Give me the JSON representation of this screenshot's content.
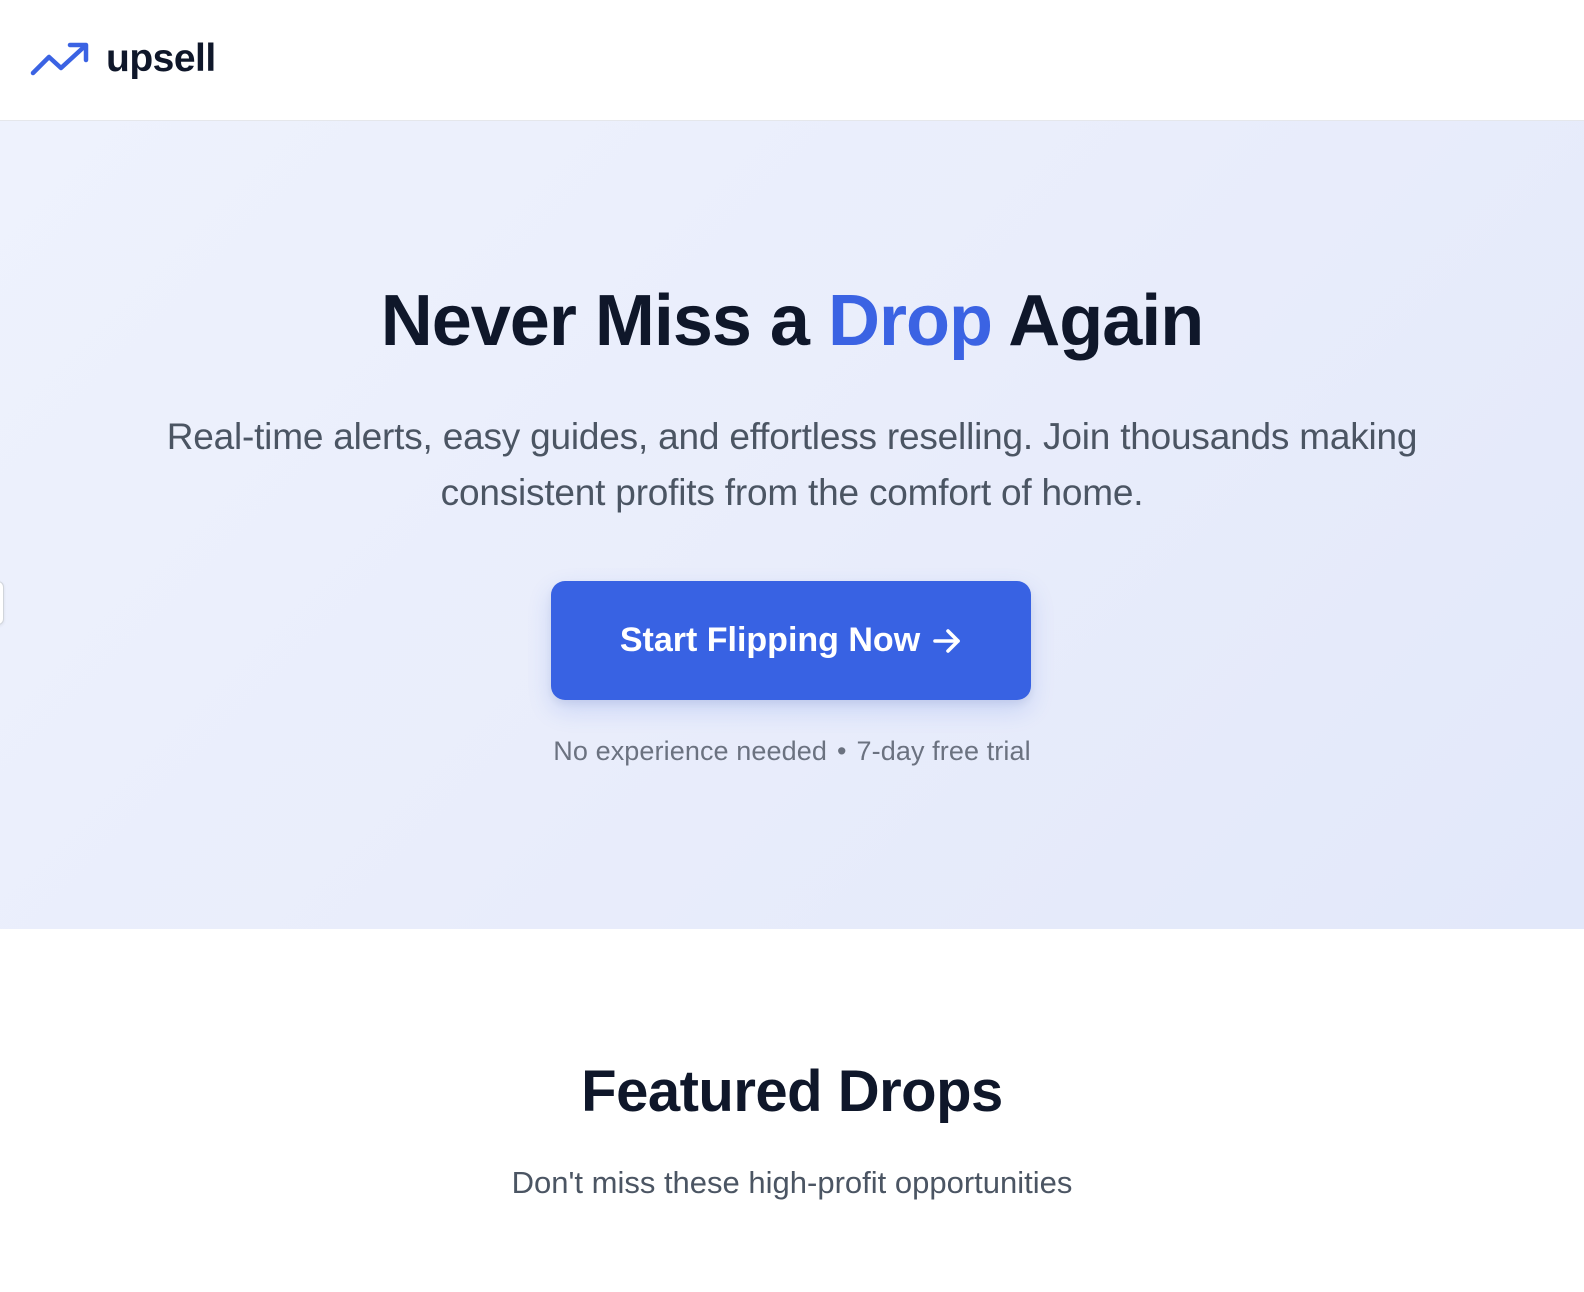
{
  "header": {
    "brand_name": "upsell",
    "brand_icon": "trending-up-icon"
  },
  "hero": {
    "title_part1": "Never Miss a ",
    "title_accent": "Drop",
    "title_part2": " Again",
    "subtitle": "Real-time alerts, easy guides, and effortless reselling. Join thousands making consistent profits from the comfort of home.",
    "cta_label": "Start Flipping Now",
    "cta_icon": "arrow-right-icon",
    "note_part1": "No experience needed",
    "note_separator": "•",
    "note_part2": "7-day free trial"
  },
  "featured": {
    "title": "Featured Drops",
    "subtitle": "Don't miss these high-profit opportunities"
  },
  "colors": {
    "accent": "#3b63e3",
    "button": "#3862e3",
    "heading": "#0f172a",
    "body_text": "#4b5563",
    "muted_text": "#6b7280",
    "hero_background": "#e9edfb"
  }
}
